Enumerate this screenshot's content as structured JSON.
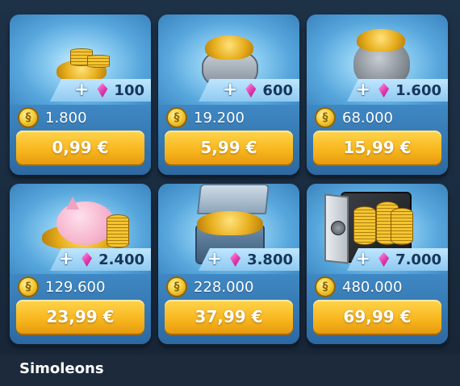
{
  "section_title": "Simoleons",
  "currency": "€",
  "packs": [
    {
      "art": "coin-pile",
      "bonus_gems": "100",
      "coins": "1.800",
      "price": "0,99 €"
    },
    {
      "art": "coin-pot",
      "bonus_gems": "600",
      "coins": "19.200",
      "price": "5,99 €"
    },
    {
      "art": "coin-sack",
      "bonus_gems": "1.600",
      "coins": "68.000",
      "price": "15,99 €"
    },
    {
      "art": "piggy-bank",
      "bonus_gems": "2.400",
      "coins": "129.600",
      "price": "23,99 €"
    },
    {
      "art": "coin-chest",
      "bonus_gems": "3.800",
      "coins": "228.000",
      "price": "37,99 €"
    },
    {
      "art": "coin-safe",
      "bonus_gems": "7.000",
      "coins": "480.000",
      "price": "69,99 €"
    }
  ],
  "icons": {
    "plus": "plus-icon",
    "gem": "pink-gem-icon",
    "coin": "simoleon-coin-icon"
  },
  "colors": {
    "price_button": "#f7b51c",
    "card": "#3f88c4",
    "gem": "#e23ab0",
    "background": "#1c2a3c"
  }
}
